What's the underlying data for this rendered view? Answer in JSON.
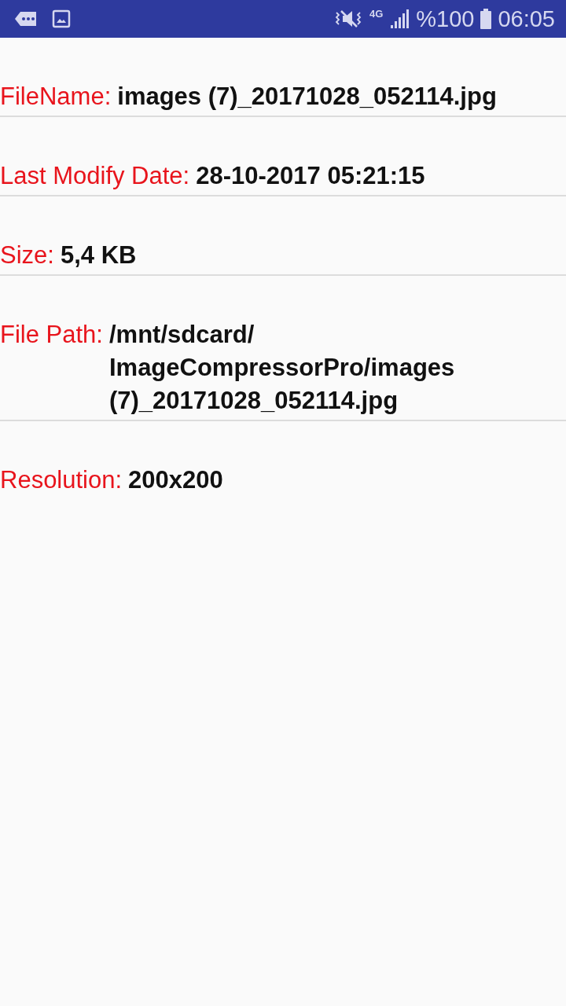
{
  "status_bar": {
    "network": "4G",
    "battery": "%100",
    "time": "06:05"
  },
  "details": [
    {
      "label": "FileName:",
      "value": "images (7)_20171028_052114.jpg"
    },
    {
      "label": "Last Modify Date:",
      "value": "28-10-2017 05:21:15"
    },
    {
      "label": "Size:",
      "value": "5,4 KB"
    },
    {
      "label": "File Path:",
      "value": "/mnt/sdcard/ImageCompressorPro/images (7)_20171028_052114.jpg"
    },
    {
      "label": "Resolution:",
      "value": "200x200"
    }
  ]
}
